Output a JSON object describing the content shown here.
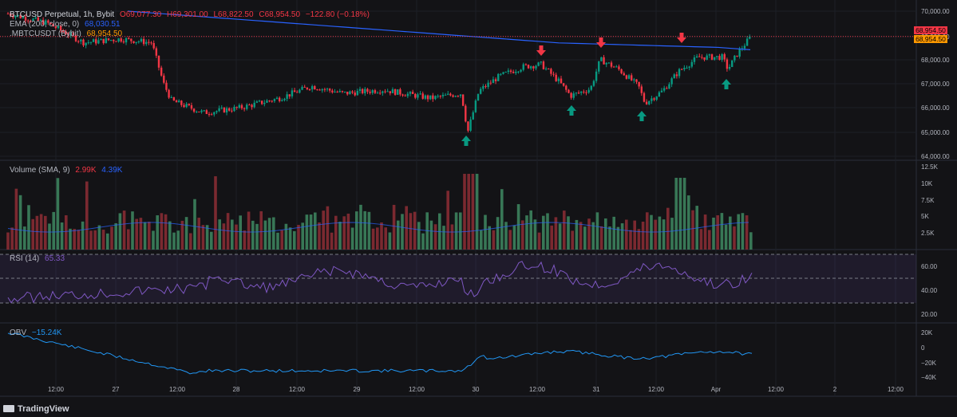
{
  "main": {
    "symbol": "BTCUSD Perpetual, 1h, Bybit",
    "open": "O69,077.30",
    "high": "H69,301.00",
    "low": "L68,822.50",
    "close": "C68,954.50",
    "change": "−122.80 (−0.18%)",
    "ema_label": "EMA (200, close, 0)",
    "ema_value": "68,030.51",
    "compare_label": ".MBTCUSDT (Bybit)",
    "compare_value": "68,954.50",
    "price_labels": [
      "70,000.00",
      "69,000.00",
      "68,000.00",
      "67,000.00",
      "66,000.00",
      "65,000.00",
      "64,000.00"
    ],
    "last_price_tag_1": "68,954.50",
    "last_price_tag_2": "68,954.50"
  },
  "volume": {
    "label": "Volume (SMA, 9)",
    "value1": "2.99K",
    "value2": "4.39K",
    "scale": [
      "12.5K",
      "10K",
      "7.5K",
      "5K",
      "2.5K"
    ]
  },
  "rsi": {
    "label": "RSI (14)",
    "value": "65.33",
    "scale": [
      "60.00",
      "40.00",
      "20.00"
    ]
  },
  "obv": {
    "label": "OBV",
    "value": "−15.24K",
    "scale": [
      "20K",
      "0",
      "−20K",
      "−40K"
    ]
  },
  "time_axis": [
    "12:00",
    "27",
    "12:00",
    "28",
    "12:00",
    "29",
    "12:00",
    "30",
    "12:00",
    "31",
    "12:00",
    "Apr",
    "12:00",
    "2",
    "12:00"
  ],
  "branding": "TradingView",
  "colors": {
    "up": "#089981",
    "down": "#f23645",
    "ema": "#2962ff",
    "rsi": "#7e57c2",
    "obv": "#2196f3",
    "bg": "#131316"
  }
}
